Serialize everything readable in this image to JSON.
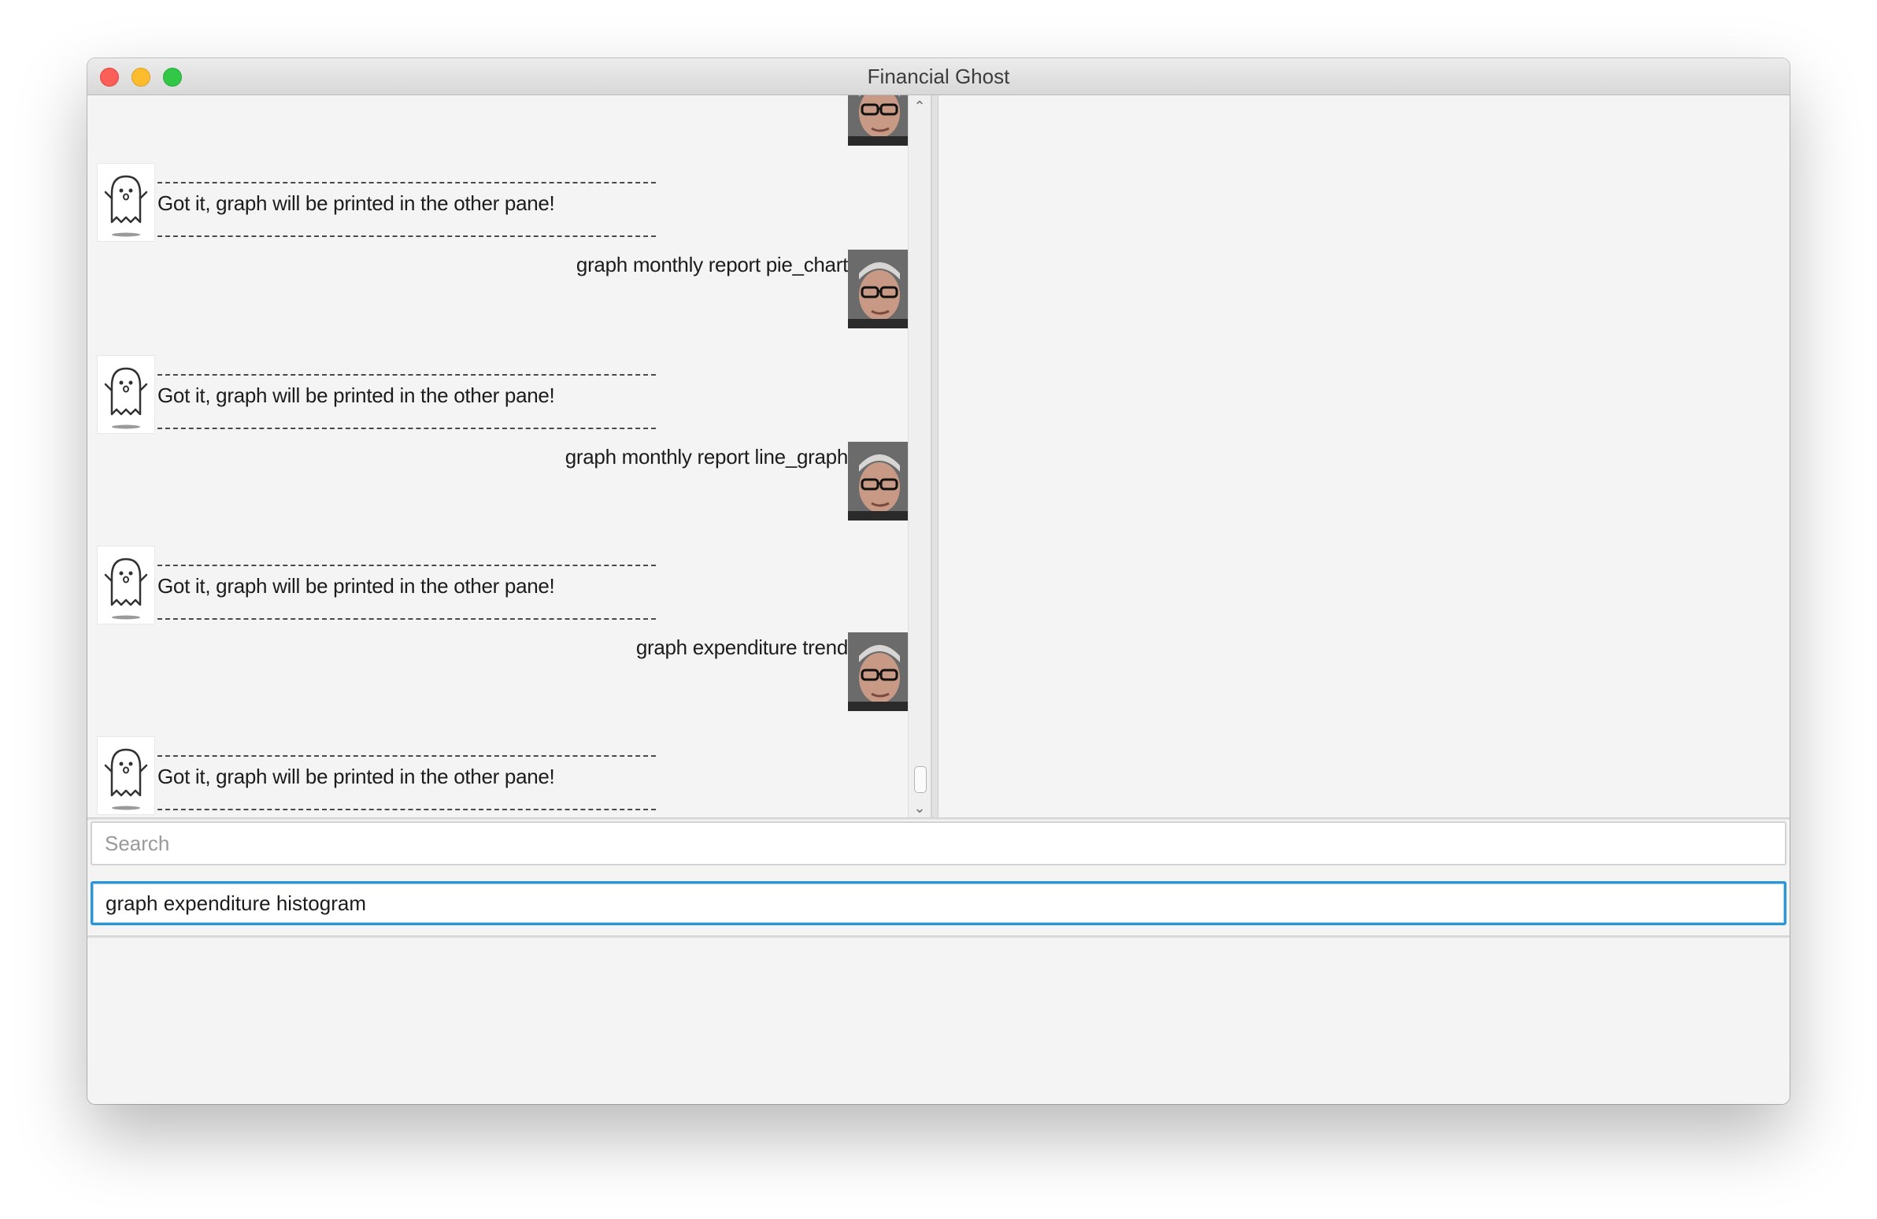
{
  "window": {
    "title": "Financial Ghost"
  },
  "chat": {
    "messages": [
      {
        "sender": "user",
        "text": ""
      },
      {
        "sender": "bot",
        "text": "Got it, graph will be printed in the other pane!"
      },
      {
        "sender": "user",
        "text": "graph monthly report pie_chart"
      },
      {
        "sender": "bot",
        "text": "Got it, graph will be printed in the other pane!"
      },
      {
        "sender": "user",
        "text": "graph monthly report line_graph"
      },
      {
        "sender": "bot",
        "text": "Got it, graph will be printed in the other pane!"
      },
      {
        "sender": "user",
        "text": "graph expenditure trend"
      },
      {
        "sender": "bot",
        "text": "Got it, graph will be printed in the other pane!"
      }
    ]
  },
  "search": {
    "placeholder": "Search",
    "value": ""
  },
  "command_input": {
    "value": "graph expenditure histogram"
  },
  "icons": {
    "bot_avatar": "ghost-icon",
    "user_avatar": "person-photo",
    "scroll_up": "chevron-up-icon",
    "scroll_down": "chevron-down-icon"
  },
  "colors": {
    "focus_ring": "#2a96d6",
    "close": "#fc5f57",
    "minimize": "#fdbc2e",
    "maximize": "#33c748"
  }
}
